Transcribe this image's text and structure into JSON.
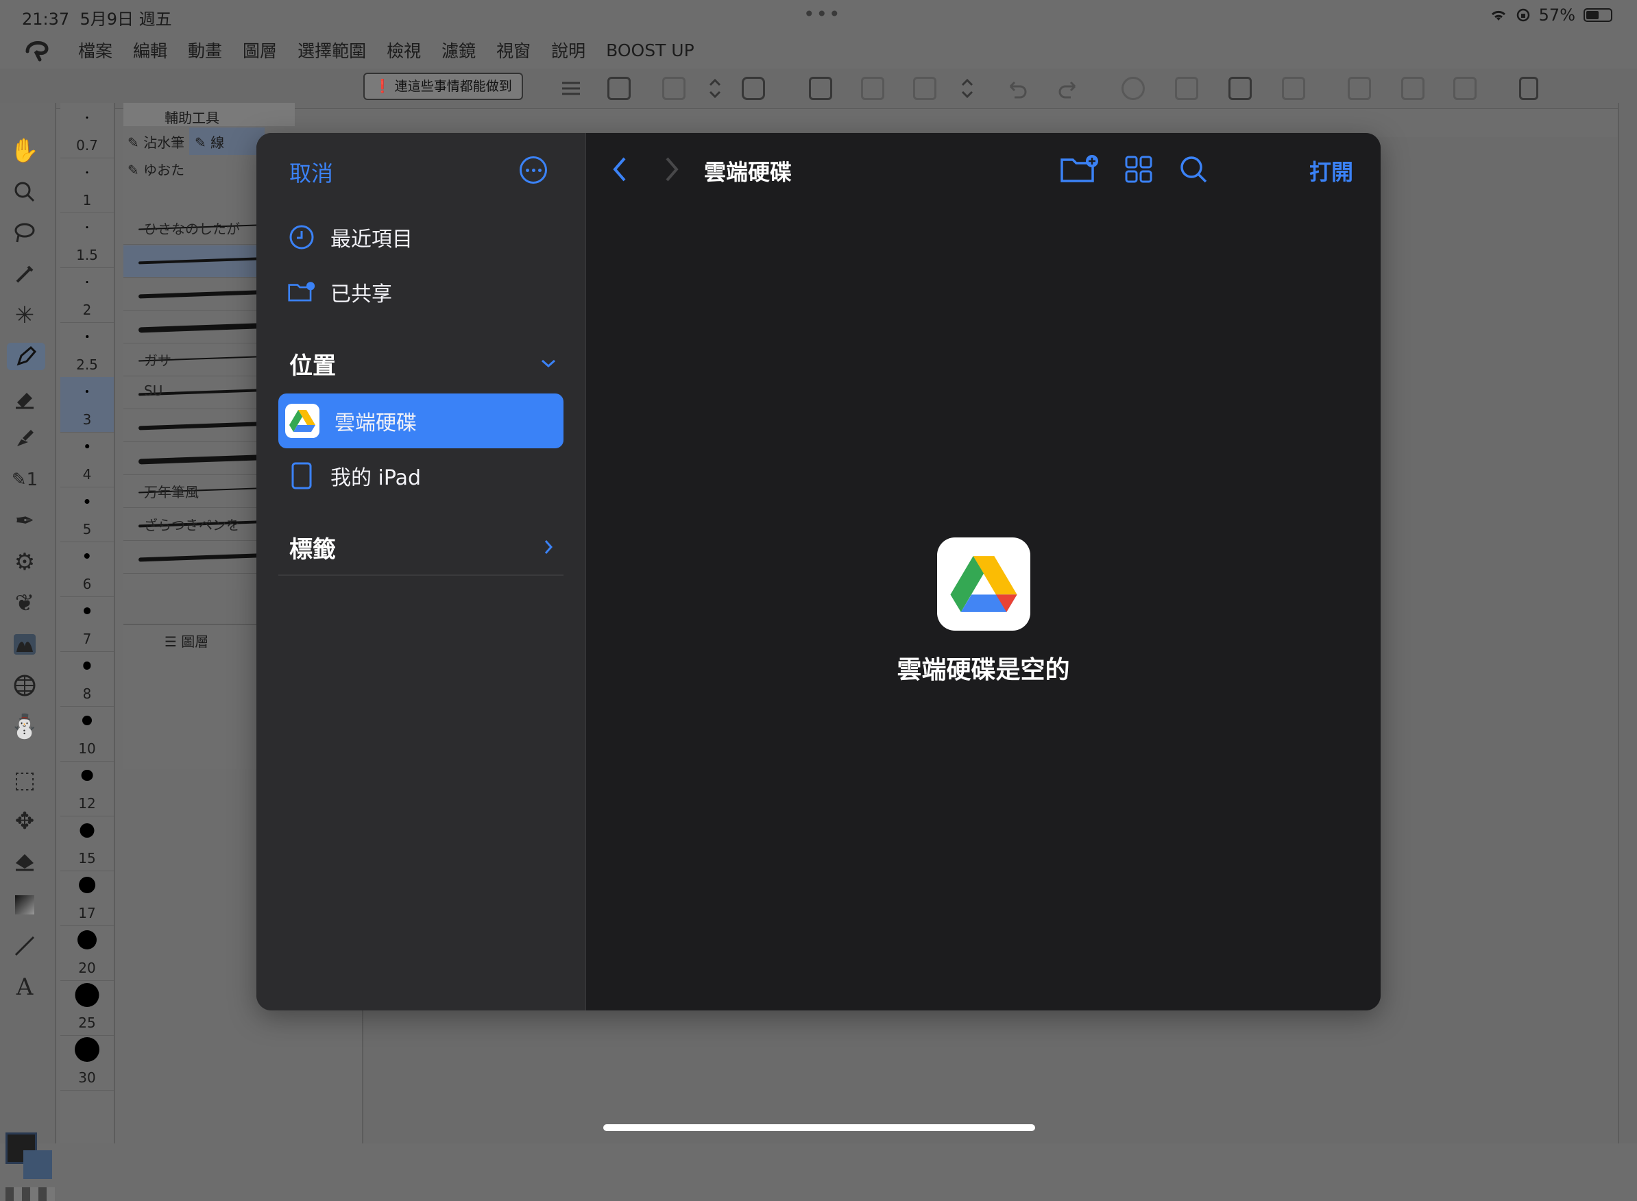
{
  "status_bar": {
    "time": "21:37",
    "date": "5月9日 週五",
    "battery": "57%",
    "battery_level": 0.57
  },
  "menu": {
    "items": [
      "檔案",
      "編輯",
      "動畫",
      "圖層",
      "選擇範圍",
      "檢視",
      "濾鏡",
      "視窗",
      "說明",
      "BOOST UP"
    ]
  },
  "toolbar": {
    "notice_label": "連這些事情都能做到"
  },
  "panels": {
    "sub_tool_tab": "輔助工具",
    "layer_tab": "圖層"
  },
  "brush_sizes": [
    "0.7",
    "1",
    "1.5",
    "2",
    "2.5",
    "3",
    "4",
    "5",
    "6",
    "7",
    "8",
    "10",
    "12",
    "15",
    "17",
    "20",
    "25",
    "30"
  ],
  "brushes": [
    {
      "label": "ひさなのしたが"
    },
    {
      "label": ""
    },
    {
      "label": ""
    },
    {
      "label": ""
    },
    {
      "label": "ガサ"
    },
    {
      "label": "SU"
    },
    {
      "label": ""
    },
    {
      "label": ""
    },
    {
      "label": "万年筆風"
    },
    {
      "label": "ざらつきペンを"
    },
    {
      "label": ""
    }
  ],
  "brush_tabs": [
    "沾水筆",
    "線",
    "ゆおた"
  ],
  "file_picker": {
    "cancel_label": "取消",
    "sidebar": {
      "recents_label": "最近項目",
      "shared_label": "已共享",
      "locations_header": "位置",
      "locations": [
        {
          "label": "雲端硬碟",
          "icon": "google-drive-icon",
          "selected": true
        },
        {
          "label": "我的 iPad",
          "icon": "ipad-icon",
          "selected": false
        }
      ],
      "tags_header": "標籤"
    },
    "main": {
      "title": "雲端硬碟",
      "open_label": "打開",
      "empty_message": "雲端硬碟是空的"
    },
    "accent_color": "#3b82f6",
    "selected_color": "#3a82f7"
  }
}
